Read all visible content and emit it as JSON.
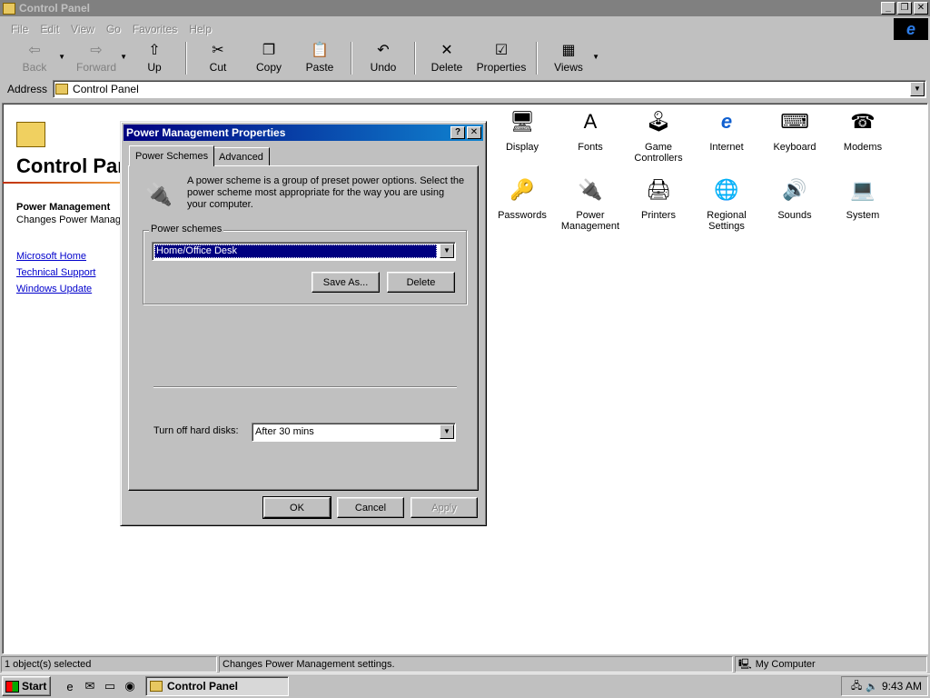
{
  "window": {
    "title": "Control Panel"
  },
  "menu": [
    {
      "label": "File"
    },
    {
      "label": "Edit"
    },
    {
      "label": "View"
    },
    {
      "label": "Go"
    },
    {
      "label": "Favorites"
    },
    {
      "label": "Help"
    }
  ],
  "toolbar": {
    "back": "Back",
    "forward": "Forward",
    "up": "Up",
    "cut": "Cut",
    "copy": "Copy",
    "paste": "Paste",
    "undo": "Undo",
    "delete": "Delete",
    "properties": "Properties",
    "views": "Views"
  },
  "address": {
    "label": "Address",
    "value": "Control Panel"
  },
  "left_pane": {
    "title": "Control Panel",
    "item_name": "Power Management",
    "item_desc": "Changes Power Management settings.",
    "links": [
      "Microsoft Home",
      "Technical Support",
      "Windows Update"
    ]
  },
  "icons": [
    {
      "label": "Display",
      "icon": "display-icon",
      "glyph": "🖥"
    },
    {
      "label": "Fonts",
      "icon": "fonts-icon",
      "glyph": "A"
    },
    {
      "label": "Game Controllers",
      "icon": "joystick-icon",
      "glyph": "🕹"
    },
    {
      "label": "Internet",
      "icon": "internet-icon",
      "glyph": "e"
    },
    {
      "label": "Keyboard",
      "icon": "keyboard-icon",
      "glyph": "⌨"
    },
    {
      "label": "Modems",
      "icon": "phone-icon",
      "glyph": "☎"
    },
    {
      "label": "Passwords",
      "icon": "keys-icon",
      "glyph": "🔑"
    },
    {
      "label": "Power Management",
      "icon": "power-plug-icon",
      "glyph": "🔌"
    },
    {
      "label": "Printers",
      "icon": "printer-icon",
      "glyph": "🖨"
    },
    {
      "label": "Regional Settings",
      "icon": "globe-icon",
      "glyph": "🌐"
    },
    {
      "label": "Sounds",
      "icon": "speaker-icon",
      "glyph": "🔊"
    },
    {
      "label": "System",
      "icon": "computer-icon",
      "glyph": "💻"
    }
  ],
  "dialog": {
    "title": "Power Management Properties",
    "tabs": [
      "Power Schemes",
      "Advanced"
    ],
    "intro": "A power scheme is a group of preset power options. Select the power scheme most appropriate for the way you are using your computer.",
    "group_label": "Power schemes",
    "scheme_value": "Home/Office Desk",
    "save_as": "Save As...",
    "delete": "Delete",
    "hd_label": "Turn off hard disks:",
    "hd_value": "After 30 mins",
    "ok": "OK",
    "cancel": "Cancel",
    "apply": "Apply"
  },
  "status": {
    "selected": "1 object(s) selected",
    "desc": "Changes Power Management settings.",
    "zone": "My Computer"
  },
  "taskbar": {
    "start": "Start",
    "task": "Control Panel",
    "clock": "9:43 AM"
  }
}
